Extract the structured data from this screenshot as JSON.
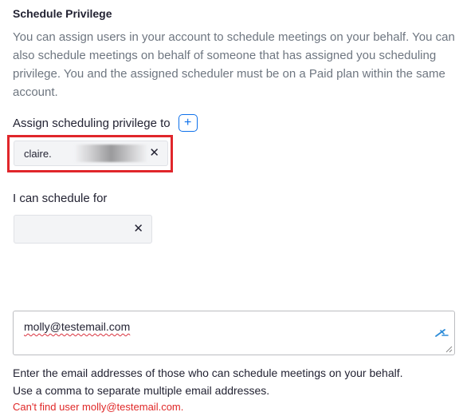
{
  "section": {
    "title": "Schedule Privilege",
    "description": "You can assign users in your account to schedule meetings on your behalf. You can also schedule meetings on behalf of someone that has assigned you scheduling privilege. You and the assigned scheduler must be on a Paid plan within the same account."
  },
  "assign": {
    "label": "Assign scheduling privilege to",
    "add_symbol": "+",
    "assignee_text": "claire.",
    "remove_symbol": "✕"
  },
  "schedule_for": {
    "label": "I can schedule for",
    "remove_symbol": "✕"
  },
  "email_input": {
    "value": "molly@testemail.com"
  },
  "help": {
    "line1": "Enter the email addresses of those who can schedule meetings on your behalf.",
    "line2": "Use a comma to separate multiple email addresses."
  },
  "error": {
    "message": "Can't find user molly@testemail.com."
  },
  "colors": {
    "accent": "#0e71eb",
    "error": "#e02828",
    "highlight": "#e0262b"
  },
  "icons": {
    "add": "plus-icon",
    "remove": "close-icon",
    "edit": "pen-icon",
    "resize": "resize-grip-icon"
  }
}
